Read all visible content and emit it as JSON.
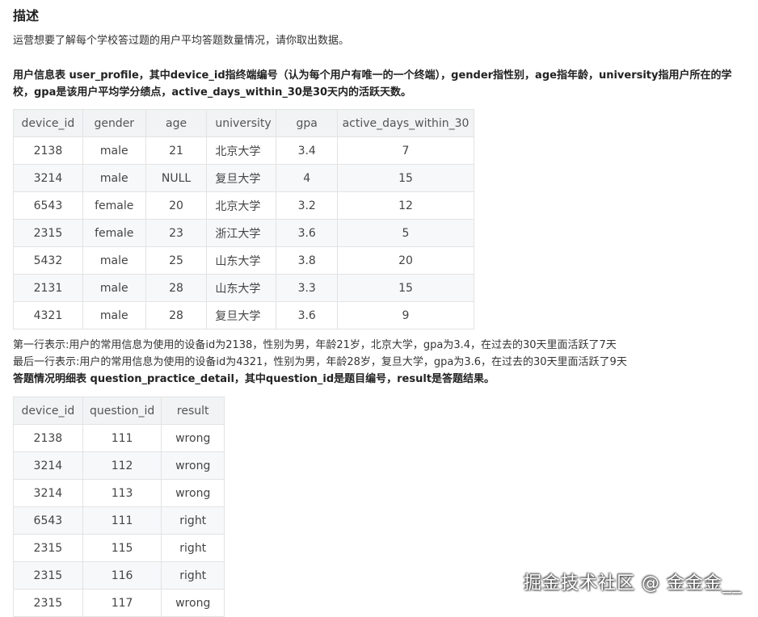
{
  "title": "描述",
  "intro": "运营想要了解每个学校答过题的用户平均答题数量情况，请你取出数据。",
  "user_profile_desc": {
    "line1": "用户信息表 user_profile，其中device_id指终端编号（认为每个用户有唯一的一个终端），gender指性别，age指年龄，university指用户所在的学",
    "line2": "校，gpa是该用户平均学分绩点，active_days_within_30是30天内的活跃天数。"
  },
  "table1": {
    "headers": [
      "device_id",
      "gender",
      "age",
      "university",
      "gpa",
      "active_days_within_30"
    ],
    "rows": [
      [
        "2138",
        "male",
        "21",
        "北京大学",
        "3.4",
        "7"
      ],
      [
        "3214",
        "male",
        "NULL",
        "复旦大学",
        "4",
        "15"
      ],
      [
        "6543",
        "female",
        "20",
        "北京大学",
        "3.2",
        "12"
      ],
      [
        "2315",
        "female",
        "23",
        "浙江大学",
        "3.6",
        "5"
      ],
      [
        "5432",
        "male",
        "25",
        "山东大学",
        "3.8",
        "20"
      ],
      [
        "2131",
        "male",
        "28",
        "山东大学",
        "3.3",
        "15"
      ],
      [
        "4321",
        "male",
        "28",
        "复旦大学",
        "3.6",
        "9"
      ]
    ]
  },
  "notes": {
    "first_row": "第一行表示:用户的常用信息为使用的设备id为2138，性别为男，年龄21岁，北京大学，gpa为3.4，在过去的30天里面活跃了7天",
    "last_row": "最后一行表示:用户的常用信息为使用的设备id为4321，性别为男，年龄28岁，复旦大学，gpa为3.6，在过去的30天里面活跃了9天",
    "detail_desc": "答题情况明细表 question_practice_detail，其中question_id是题目编号，result是答题结果。"
  },
  "table2": {
    "headers": [
      "device_id",
      "question_id",
      "result"
    ],
    "rows": [
      [
        "2138",
        "111",
        "wrong"
      ],
      [
        "3214",
        "112",
        "wrong"
      ],
      [
        "3214",
        "113",
        "wrong"
      ],
      [
        "6543",
        "111",
        "right"
      ],
      [
        "2315",
        "115",
        "right"
      ],
      [
        "2315",
        "116",
        "right"
      ],
      [
        "2315",
        "117",
        "wrong"
      ]
    ]
  },
  "watermark": "掘金技术社区 @ 金金金__"
}
